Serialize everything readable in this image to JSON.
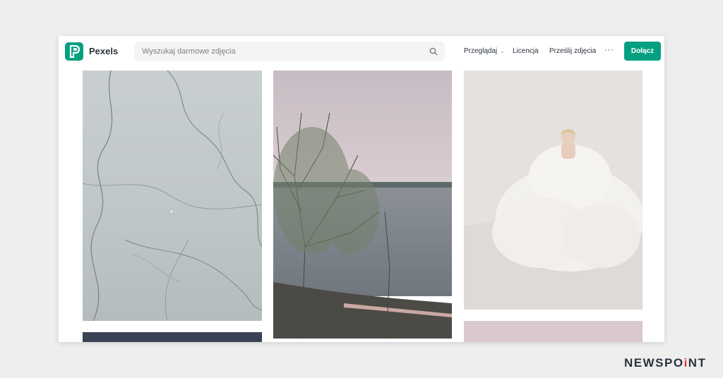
{
  "header": {
    "brand": "Pexels",
    "search_placeholder": "Wyszukaj darmowe zdjęcia",
    "nav": {
      "browse": "Przeglądaj",
      "license": "Licencja",
      "upload": "Prześlij zdjęcia",
      "more": "···"
    },
    "join_label": "Dołącz"
  },
  "colors": {
    "accent": "#05a081",
    "page_bg": "#eeeeee"
  },
  "footer": {
    "logo_part1": "NEWSPO",
    "logo_accent": "i",
    "logo_part2": "NT"
  }
}
